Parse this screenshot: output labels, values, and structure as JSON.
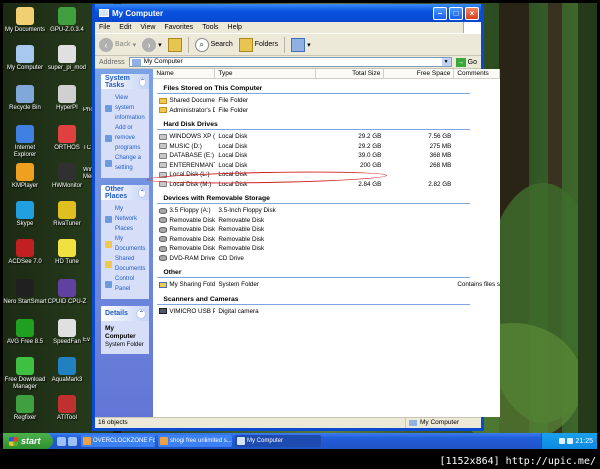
{
  "desktop_icons": [
    {
      "label": "My Documents",
      "color": "#f0d070"
    },
    {
      "label": "GPU-Z.0.3.4",
      "color": "#40a040"
    },
    {
      "label": "My Computer",
      "color": "#a8c8f0"
    },
    {
      "label": "super_pi_mod",
      "color": "#e0e0e0"
    },
    {
      "label": "Recycle Bin",
      "color": "#80a8d8"
    },
    {
      "label": "HyperPI",
      "color": "#d0d0d0"
    },
    {
      "label": "Internet Explorer",
      "color": "#4080e0"
    },
    {
      "label": "ORTHOS",
      "color": "#e04040"
    },
    {
      "label": "KMPlayer",
      "color": "#f0a020"
    },
    {
      "label": "HWMonitor",
      "color": "#303030"
    },
    {
      "label": "Skype",
      "color": "#20a0e0"
    },
    {
      "label": "RivaTuner",
      "color": "#e0c020"
    },
    {
      "label": "ACDSee 7.0",
      "color": "#c02020"
    },
    {
      "label": "HD Tune",
      "color": "#f0e040"
    },
    {
      "label": "Nero StartSmart",
      "color": "#202020"
    },
    {
      "label": "CPUID CPU-Z",
      "color": "#6040a0"
    },
    {
      "label": "AVG Free 8.5",
      "color": "#20a020"
    },
    {
      "label": "SpeedFan",
      "color": "#e0e0e0"
    },
    {
      "label": "Free Download Manager",
      "color": "#40c040"
    },
    {
      "label": "AquaMark3",
      "color": "#2080c0"
    },
    {
      "label": "Regfixer",
      "color": "#40a040"
    },
    {
      "label": "ATITool",
      "color": "#c03030"
    }
  ],
  "desktop_partial_labels": [
    "Pho",
    "TC",
    "Win Med",
    "Ev"
  ],
  "window": {
    "title": "My Computer",
    "menu": [
      "File",
      "Edit",
      "View",
      "Favorites",
      "Tools",
      "Help"
    ],
    "toolbar": {
      "back": "Back",
      "search": "Search",
      "folders": "Folders"
    },
    "address_label": "Address",
    "address_value": "My Computer",
    "go_label": "Go"
  },
  "taskpane": {
    "system_tasks": {
      "title": "System Tasks",
      "links": [
        "View system information",
        "Add or remove programs",
        "Change a setting"
      ]
    },
    "other_places": {
      "title": "Other Places",
      "links": [
        "My Network Places",
        "My Documents",
        "Shared Documents",
        "Control Panel"
      ]
    },
    "details": {
      "title": "Details",
      "name": "My Computer",
      "sub": "System Folder"
    }
  },
  "columns": {
    "name": "Name",
    "type": "Type",
    "total": "Total Size",
    "free": "Free Space",
    "comments": "Comments"
  },
  "groups": [
    {
      "title": "Files Stored on This Computer",
      "rows": [
        {
          "name": "Shared Documents",
          "type": "File Folder",
          "total": "",
          "free": "",
          "comments": "",
          "icon": "folder"
        },
        {
          "name": "Administrator's D...",
          "type": "File Folder",
          "total": "",
          "free": "",
          "comments": "",
          "icon": "folder"
        }
      ]
    },
    {
      "title": "Hard Disk Drives",
      "rows": [
        {
          "name": "WINDOWS XP (C:)",
          "type": "Local Disk",
          "total": "29.2 GB",
          "free": "7.56 GB",
          "comments": "",
          "icon": "disk"
        },
        {
          "name": "MUSIC (D:)",
          "type": "Local Disk",
          "total": "29.2 GB",
          "free": "275 MB",
          "comments": "",
          "icon": "disk"
        },
        {
          "name": "DATABASE (E:)",
          "type": "Local Disk",
          "total": "39.0 GB",
          "free": "368 MB",
          "comments": "",
          "icon": "disk"
        },
        {
          "name": "ENTERENMANT (F:)",
          "type": "Local Disk",
          "total": "200 GB",
          "free": "268 MB",
          "comments": "",
          "icon": "disk"
        },
        {
          "name": "Local Disk (L:)",
          "type": "Local Disk",
          "total": "",
          "free": "",
          "comments": "",
          "icon": "disk"
        },
        {
          "name": "Local Disk (M:)",
          "type": "Local Disk",
          "total": "2.84 GB",
          "free": "2.82 GB",
          "comments": "",
          "icon": "disk"
        }
      ]
    },
    {
      "title": "Devices with Removable Storage",
      "rows": [
        {
          "name": "3.5 Floppy (A:)",
          "type": "3.5-Inch Floppy Disk",
          "total": "",
          "free": "",
          "comments": "",
          "icon": "rem"
        },
        {
          "name": "Removable Disk (...",
          "type": "Removable Disk",
          "total": "",
          "free": "",
          "comments": "",
          "icon": "rem"
        },
        {
          "name": "Removable Disk (...",
          "type": "Removable Disk",
          "total": "",
          "free": "",
          "comments": "",
          "icon": "rem"
        },
        {
          "name": "Removable Disk (I:)",
          "type": "Removable Disk",
          "total": "",
          "free": "",
          "comments": "",
          "icon": "rem"
        },
        {
          "name": "Removable Disk (J:)",
          "type": "Removable Disk",
          "total": "",
          "free": "",
          "comments": "",
          "icon": "rem"
        },
        {
          "name": "DVD-RAM Drive (K:)",
          "type": "CD Drive",
          "total": "",
          "free": "",
          "comments": "",
          "icon": "rem"
        }
      ]
    },
    {
      "title": "Other",
      "rows": [
        {
          "name": "My Sharing Folders",
          "type": "System Folder",
          "total": "",
          "free": "",
          "comments": "Contains files s",
          "icon": "share"
        }
      ]
    },
    {
      "title": "Scanners and Cameras",
      "rows": [
        {
          "name": "VIMICRO USB PC ...",
          "type": "Digital camera",
          "total": "",
          "free": "",
          "comments": "",
          "icon": "cam"
        }
      ]
    }
  ],
  "status": {
    "count": "16 objects",
    "location": "My Computer"
  },
  "taskbar": {
    "start": "start",
    "tasks": [
      "OVERCLOCKZONE Fo...",
      "shogi free unlimited s...",
      "My Computer"
    ],
    "clock": "21:25"
  },
  "watermark": "[1152x864] http://upic.me/"
}
